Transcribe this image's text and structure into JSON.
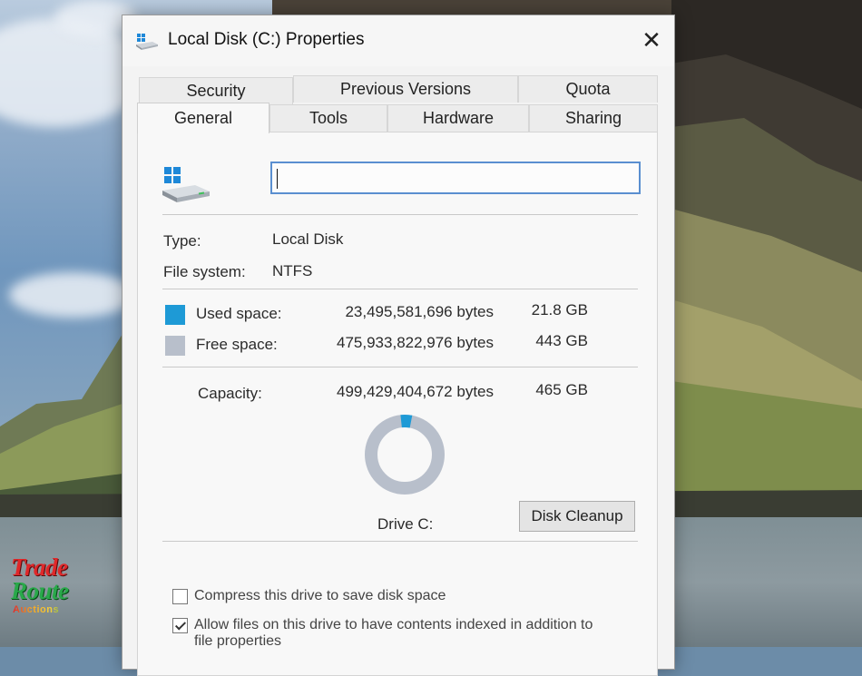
{
  "watermark": {
    "line1": "Trade",
    "line2": "Route",
    "line3": "Auctions"
  },
  "dialog": {
    "title": "Local Disk (C:) Properties",
    "close_glyph": "✕",
    "tabs_back": [
      "Security",
      "Previous Versions",
      "Quota"
    ],
    "tabs_front": [
      "General",
      "Tools",
      "Hardware",
      "Sharing"
    ],
    "active_tab": "General",
    "drive_name_value": "",
    "type_label": "Type:",
    "type_value": "Local Disk",
    "fs_label": "File system:",
    "fs_value": "NTFS",
    "used": {
      "label": "Used space:",
      "bytes": "23,495,581,696 bytes",
      "size": "21.8 GB",
      "color": "#1e9ad6"
    },
    "free": {
      "label": "Free space:",
      "bytes": "475,933,822,976 bytes",
      "size": "443 GB",
      "color": "#b8bfcb"
    },
    "capacity": {
      "label": "Capacity:",
      "bytes": "499,429,404,672 bytes",
      "size": "465 GB"
    },
    "used_fraction": 0.047,
    "drive_label": "Drive C:",
    "cleanup_button": "Disk Cleanup",
    "compress_label": "Compress this drive to save disk space",
    "compress_checked": false,
    "index_label": "Allow files on this drive to have contents indexed in addition to",
    "index_label_cont": "file properties",
    "index_checked": true
  }
}
